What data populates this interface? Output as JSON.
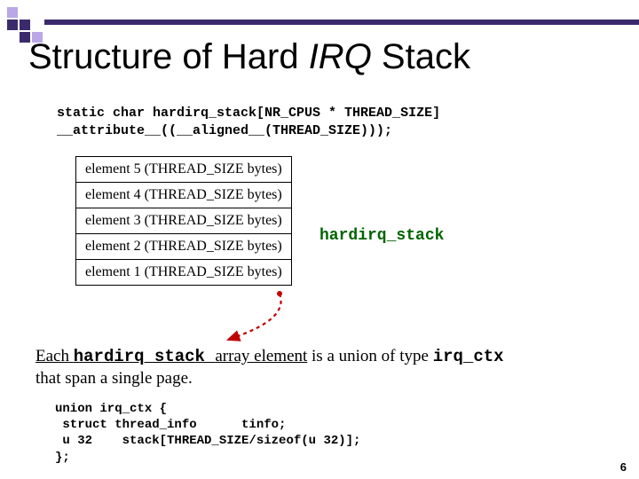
{
  "title": {
    "pre": "Structure of Hard ",
    "ital": "IRQ",
    "post": " Stack"
  },
  "decl": {
    "line1": "static char hardirq_stack[NR_CPUS * THREAD_SIZE]",
    "line2": "__attribute__((__aligned__(THREAD_SIZE)));"
  },
  "stack": {
    "rows": [
      "element 5 (THREAD_SIZE bytes)",
      "element 4 (THREAD_SIZE bytes)",
      "element 3 (THREAD_SIZE bytes)",
      "element 2 (THREAD_SIZE bytes)",
      "element 1 (THREAD_SIZE bytes)"
    ],
    "label": "hardirq_stack"
  },
  "explain": {
    "lead": "Each ",
    "code1": "hardirq_stack ",
    "mid1_u": "array element",
    "mid2": " is a union of type ",
    "code2": "irq_ctx",
    "tail": "that span a single page."
  },
  "union": {
    "l1": "union irq_ctx {",
    "l2": " struct thread_info      tinfo;",
    "l3": " u 32    stack[THREAD_SIZE/sizeof(u 32)];",
    "l4": "};"
  },
  "page": "6",
  "arrow_color": "#c00000"
}
